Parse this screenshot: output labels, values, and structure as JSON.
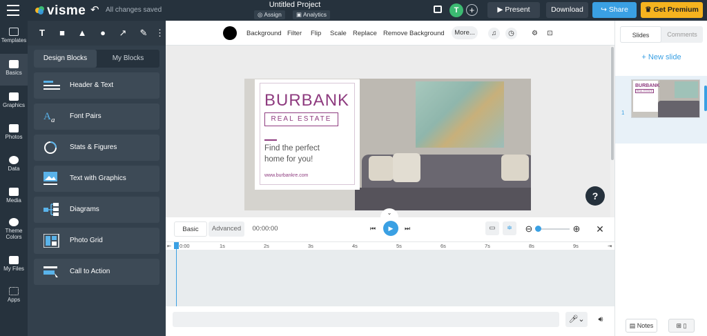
{
  "app": {
    "logo": "visme",
    "save_status": "All changes saved"
  },
  "project": {
    "title": "Untitled Project",
    "assign_label": "Assign",
    "analytics_label": "Analytics"
  },
  "header": {
    "avatar_initial": "T",
    "present_label": "Present",
    "download_label": "Download",
    "share_label": "Share",
    "premium_label": "Get Premium"
  },
  "left_nav": {
    "items": [
      {
        "label": "Templates",
        "icon": "templates-icon"
      },
      {
        "label": "Basics",
        "icon": "basics-icon"
      },
      {
        "label": "Graphics",
        "icon": "graphics-icon"
      },
      {
        "label": "Photos",
        "icon": "photos-icon"
      },
      {
        "label": "Data",
        "icon": "data-icon"
      },
      {
        "label": "Media",
        "icon": "media-icon"
      },
      {
        "label": "Theme",
        "label2": "Colors",
        "icon": "theme-colors-icon"
      },
      {
        "label": "My Files",
        "icon": "my-files-icon"
      },
      {
        "label": "Apps",
        "icon": "apps-icon"
      }
    ]
  },
  "blocks_panel": {
    "tabs": [
      "Design Blocks",
      "My Blocks"
    ],
    "items": [
      "Header & Text",
      "Font Pairs",
      "Stats & Figures",
      "Text with Graphics",
      "Diagrams",
      "Photo Grid",
      "Call to Action"
    ]
  },
  "context_toolbar": {
    "items": [
      "Background",
      "Filter",
      "Flip",
      "Scale",
      "Replace",
      "Remove Background"
    ],
    "more_label": "More..."
  },
  "slide": {
    "brand": "BURBANK",
    "subtitle": "REAL ESTATE",
    "tagline": "Find the perfect home for you!",
    "url": "www.burbankre.com"
  },
  "help": {
    "label": "?"
  },
  "timeline": {
    "tabs": [
      "Basic",
      "Advanced"
    ],
    "time": "00:00:00",
    "ticks": [
      "0:00",
      "1s",
      "2s",
      "3s",
      "4s",
      "5s",
      "6s",
      "7s",
      "8s",
      "9s"
    ]
  },
  "right_panel": {
    "tabs": [
      "Slides",
      "Comments"
    ],
    "new_slide_label": "+ New slide",
    "slide_number": "1",
    "thumb_brand": "BURBANK",
    "thumb_subtitle": "REAL ESTATE"
  },
  "footer": {
    "notes_label": "Notes"
  },
  "colors": {
    "accent": "#3aa0e3",
    "brand": "#8e3b7f",
    "dark": "#26323d",
    "premium": "#f5b31f"
  }
}
